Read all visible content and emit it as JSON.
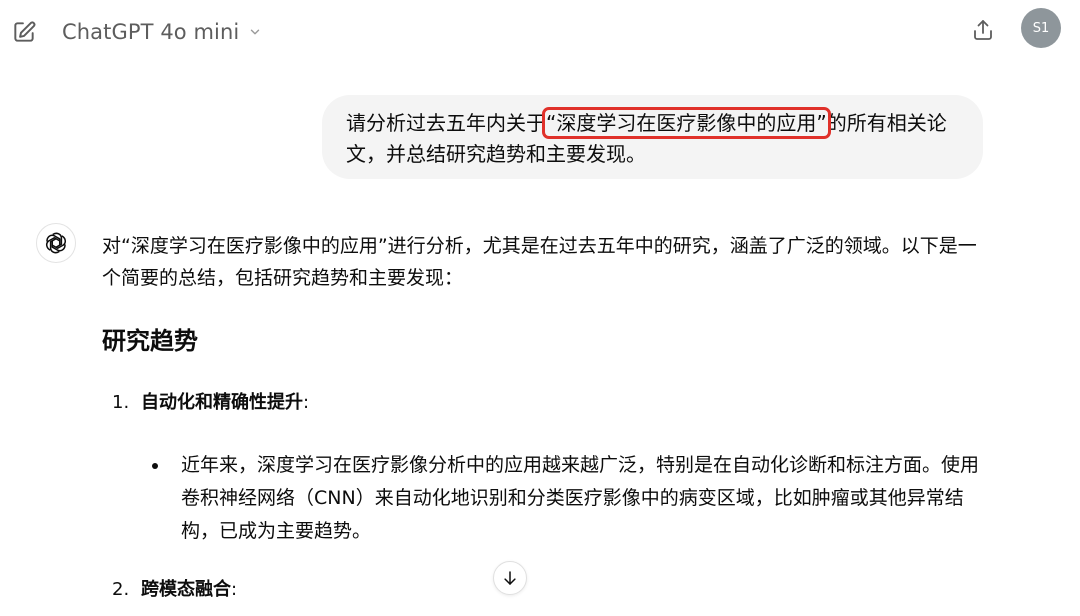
{
  "header": {
    "model_name": "ChatGPT 4o mini",
    "avatar_initials": "S1"
  },
  "user_message": {
    "prefix": "请分析过去五年内关于",
    "highlight": "“深度学习在医疗影像中的应用”",
    "suffix": "的所有相关论文，并总结研究趋势和主要发现。",
    "highlight_color": "#e0312a"
  },
  "assistant_message": {
    "intro": "对“深度学习在医疗影像中的应用”进行分析，尤其是在过去五年中的研究，涵盖了广泛的领域。以下是一个简要的总结，包括研究趋势和主要发现：",
    "heading": "研究趋势",
    "list": [
      {
        "number": "1.",
        "title": "自动化和精确性提升",
        "colon": ":",
        "bullet": "近年来，深度学习在医疗影像分析中的应用越来越广泛，特别是在自动化诊断和标注方面。使用卷积神经网络（CNN）来自动化地识别和分类医疗影像中的病变区域，比如肿瘤或其他异常结构，已成为主要趋势。"
      },
      {
        "number": "2.",
        "title": "跨模态融合",
        "colon": ":"
      }
    ]
  },
  "icons": {
    "edit": "edit-icon",
    "chevron": "chevron-down-icon",
    "share": "share-icon",
    "assistant": "openai-logo-icon",
    "scroll": "arrow-down-icon"
  }
}
